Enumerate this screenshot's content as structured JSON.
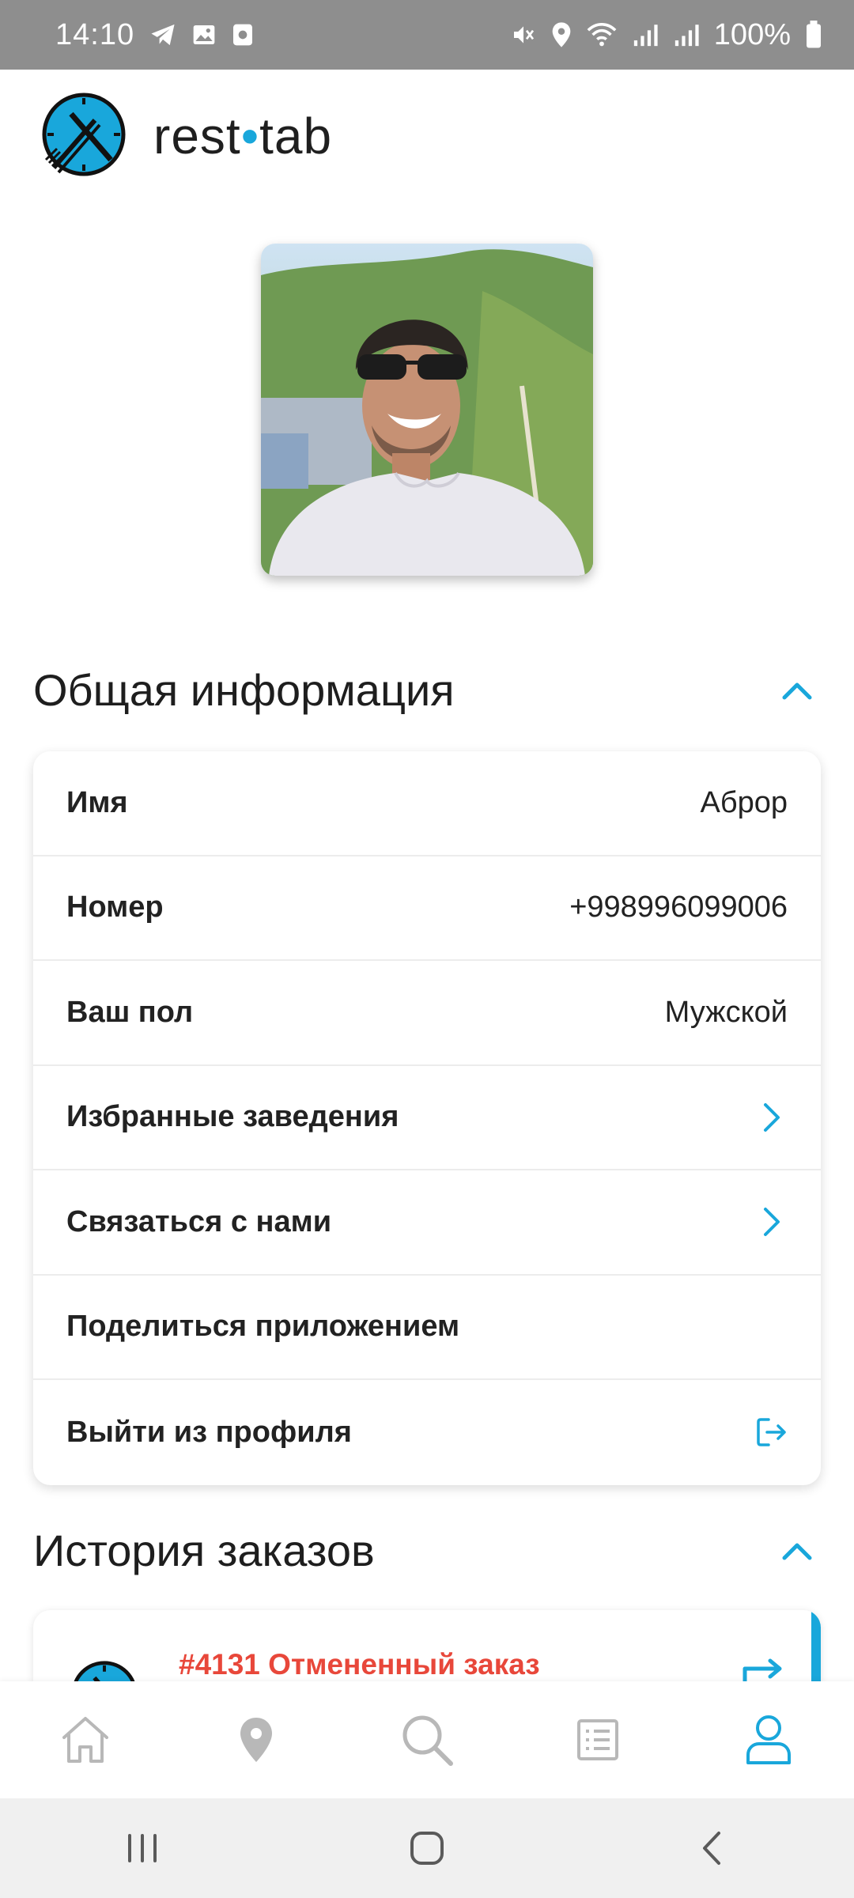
{
  "status_bar": {
    "time": "14:10",
    "battery": "100%",
    "left_icons": [
      "telegram-icon",
      "gallery-icon",
      "screen-recorder-icon"
    ],
    "right_icons": [
      "mute-icon",
      "location-icon",
      "wifi-icon",
      "signal-icon",
      "signal-icon",
      "battery-icon"
    ]
  },
  "header": {
    "brand_left": "rest",
    "brand_dot": "•",
    "brand_right": "tab",
    "logo_icon": "clock-fork-knife-logo"
  },
  "profile": {
    "avatar_alt": "profile photo"
  },
  "general_info": {
    "title": "Общая информация",
    "rows": [
      {
        "label": "Имя",
        "value": "Аброр"
      },
      {
        "label": "Номер",
        "value": "+998996099006"
      },
      {
        "label": "Ваш пол",
        "value": "Мужской"
      },
      {
        "label": "Избранные заведения",
        "icon": "chevron-right-icon"
      },
      {
        "label": "Связаться с нами",
        "icon": "chevron-right-icon"
      },
      {
        "label": "Поделиться приложением"
      },
      {
        "label": "Выйти из профиля",
        "icon": "logout-icon"
      }
    ]
  },
  "order_history": {
    "title": "История заказов",
    "orders": [
      {
        "title": "#4131 Отмененный заказ"
      }
    ]
  },
  "bottom_nav": {
    "items": [
      "home-icon",
      "location-icon",
      "search-icon",
      "orders-list-icon",
      "profile-icon"
    ],
    "active": "profile-icon"
  },
  "colors": {
    "accent": "#19a7db",
    "danger": "#e8473a",
    "inactive": "#b8b8b8",
    "status_bar": "#8e8e8e"
  }
}
